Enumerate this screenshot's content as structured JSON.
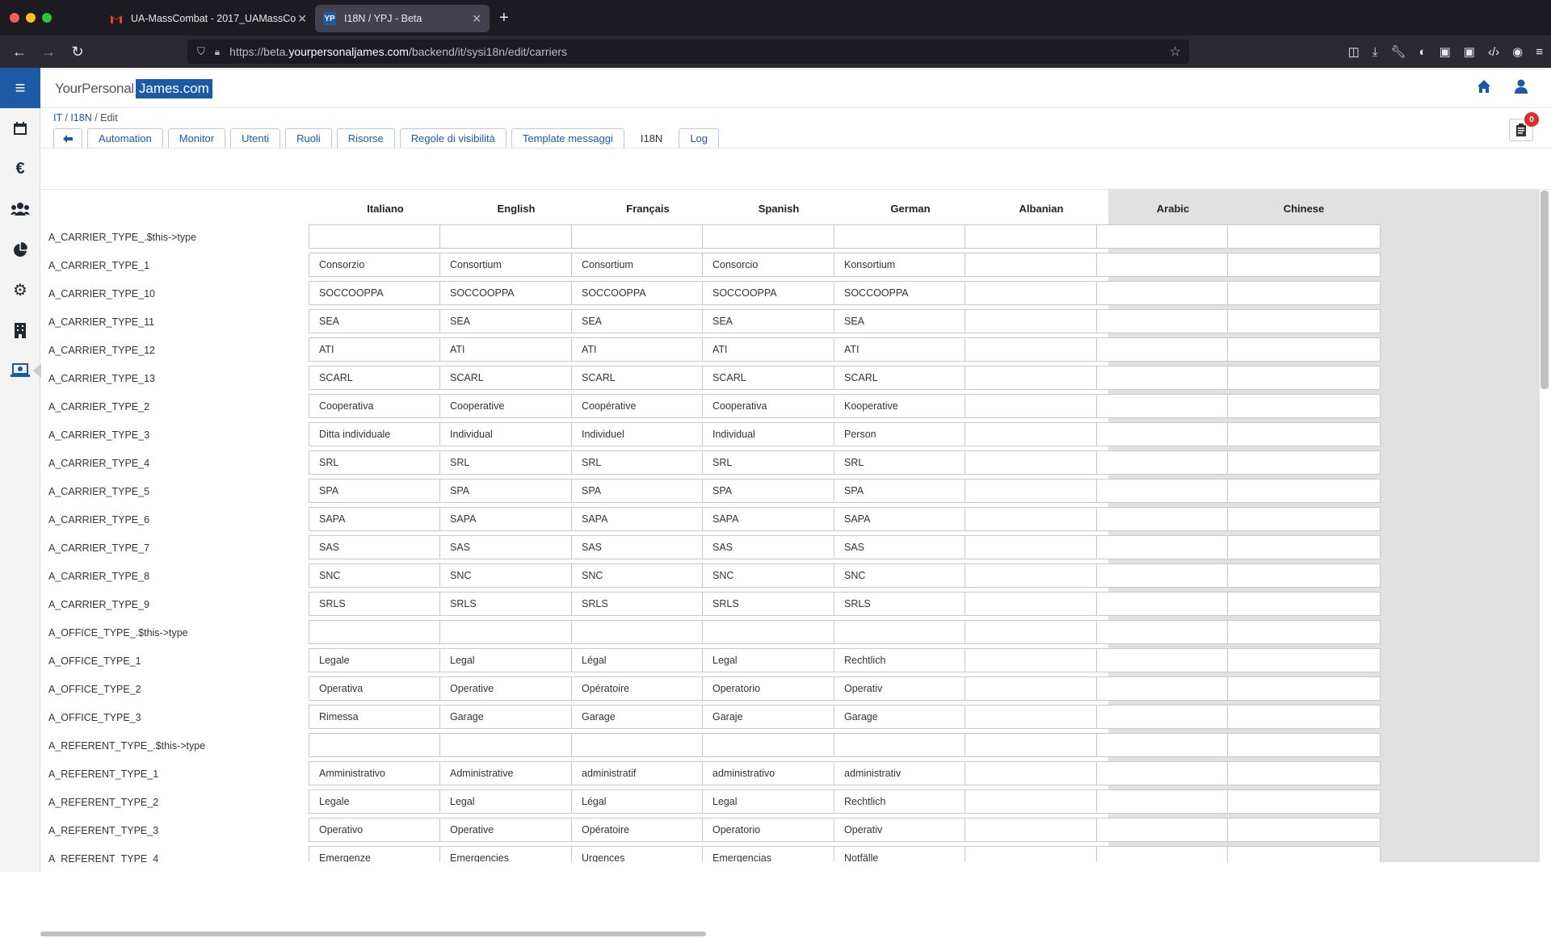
{
  "browser": {
    "tabs": [
      {
        "label": "UA-MassCombat - 2017_UAMassCo",
        "icon": "gmail-icon"
      },
      {
        "label": "I18N / YPJ - Beta",
        "icon": "ypj-icon",
        "favicon_text": "YP"
      }
    ],
    "url_prefix": "https://beta.",
    "url_domain": "yourpersonaljames.com",
    "url_path": "/backend/it/sysi18n/edit/carriers"
  },
  "app": {
    "logo_part1": "YourPersonal",
    "logo_part2": "James.com",
    "breadcrumb": [
      "IT",
      "I18N",
      "Edit"
    ],
    "notifications_count": "0",
    "accent_color": "#1c5aa6"
  },
  "tabs": [
    "Automation",
    "Monitor",
    "Utenti",
    "Ruoli",
    "Risorse",
    "Regole di visibilità",
    "Template messaggi",
    "I18N",
    "Log"
  ],
  "active_tab": "I18N",
  "columns": [
    "Italiano",
    "English",
    "Français",
    "Spanish",
    "German",
    "Albanian",
    "Arabic",
    "Chinese"
  ],
  "rows": [
    {
      "key": "A_CARRIER_TYPE_.$this->type",
      "values": [
        "",
        "",
        "",
        "",
        ""
      ]
    },
    {
      "key": "A_CARRIER_TYPE_1",
      "values": [
        "Consorzio",
        "Consortium",
        "Consortium",
        "Consorcio",
        "Konsortium"
      ]
    },
    {
      "key": "A_CARRIER_TYPE_10",
      "values": [
        "SOCCOOPPA",
        "SOCCOOPPA",
        "SOCCOOPPA",
        "SOCCOOPPA",
        "SOCCOOPPA"
      ]
    },
    {
      "key": "A_CARRIER_TYPE_11",
      "values": [
        "SEA",
        "SEA",
        "SEA",
        "SEA",
        "SEA"
      ]
    },
    {
      "key": "A_CARRIER_TYPE_12",
      "values": [
        "ATI",
        "ATI",
        "ATI",
        "ATI",
        "ATI"
      ]
    },
    {
      "key": "A_CARRIER_TYPE_13",
      "values": [
        "SCARL",
        "SCARL",
        "SCARL",
        "SCARL",
        "SCARL"
      ]
    },
    {
      "key": "A_CARRIER_TYPE_2",
      "values": [
        "Cooperativa",
        "Cooperative",
        "Coopérative",
        "Cooperativa",
        "Kooperative"
      ]
    },
    {
      "key": "A_CARRIER_TYPE_3",
      "values": [
        "Ditta individuale",
        "Individual",
        "Individuel",
        "Individual",
        "Person"
      ]
    },
    {
      "key": "A_CARRIER_TYPE_4",
      "values": [
        "SRL",
        "SRL",
        "SRL",
        "SRL",
        "SRL"
      ]
    },
    {
      "key": "A_CARRIER_TYPE_5",
      "values": [
        "SPA",
        "SPA",
        "SPA",
        "SPA",
        "SPA"
      ]
    },
    {
      "key": "A_CARRIER_TYPE_6",
      "values": [
        "SAPA",
        "SAPA",
        "SAPA",
        "SAPA",
        "SAPA"
      ]
    },
    {
      "key": "A_CARRIER_TYPE_7",
      "values": [
        "SAS",
        "SAS",
        "SAS",
        "SAS",
        "SAS"
      ]
    },
    {
      "key": "A_CARRIER_TYPE_8",
      "values": [
        "SNC",
        "SNC",
        "SNC",
        "SNC",
        "SNC"
      ]
    },
    {
      "key": "A_CARRIER_TYPE_9",
      "values": [
        "SRLS",
        "SRLS",
        "SRLS",
        "SRLS",
        "SRLS"
      ]
    },
    {
      "key": "A_OFFICE_TYPE_.$this->type",
      "values": [
        "",
        "",
        "",
        "",
        ""
      ]
    },
    {
      "key": "A_OFFICE_TYPE_1",
      "values": [
        "Legale",
        "Legal",
        "Légal",
        "Legal",
        "Rechtlich"
      ]
    },
    {
      "key": "A_OFFICE_TYPE_2",
      "values": [
        "Operativa",
        "Operative",
        "Opératoire",
        "Operatorio",
        "Operativ"
      ]
    },
    {
      "key": "A_OFFICE_TYPE_3",
      "values": [
        "Rimessa",
        "Garage",
        "Garage",
        "Garaje",
        "Garage"
      ]
    },
    {
      "key": "A_REFERENT_TYPE_.$this->type",
      "values": [
        "",
        "",
        "",
        "",
        ""
      ]
    },
    {
      "key": "A_REFERENT_TYPE_1",
      "values": [
        "Amministrativo",
        "Administrative",
        "administratif",
        "administrativo",
        "administrativ"
      ]
    },
    {
      "key": "A_REFERENT_TYPE_2",
      "values": [
        "Legale",
        "Legal",
        "Légal",
        "Legal",
        "Rechtlich"
      ]
    },
    {
      "key": "A_REFERENT_TYPE_3",
      "values": [
        "Operativo",
        "Operative",
        "Opératoire",
        "Operatorio",
        "Operativ"
      ]
    },
    {
      "key": "A_REFERENT_TYPE_4",
      "values": [
        "Emergenze",
        "Emergencies",
        "Urgences",
        "Emergencias",
        "Notfälle"
      ]
    }
  ]
}
